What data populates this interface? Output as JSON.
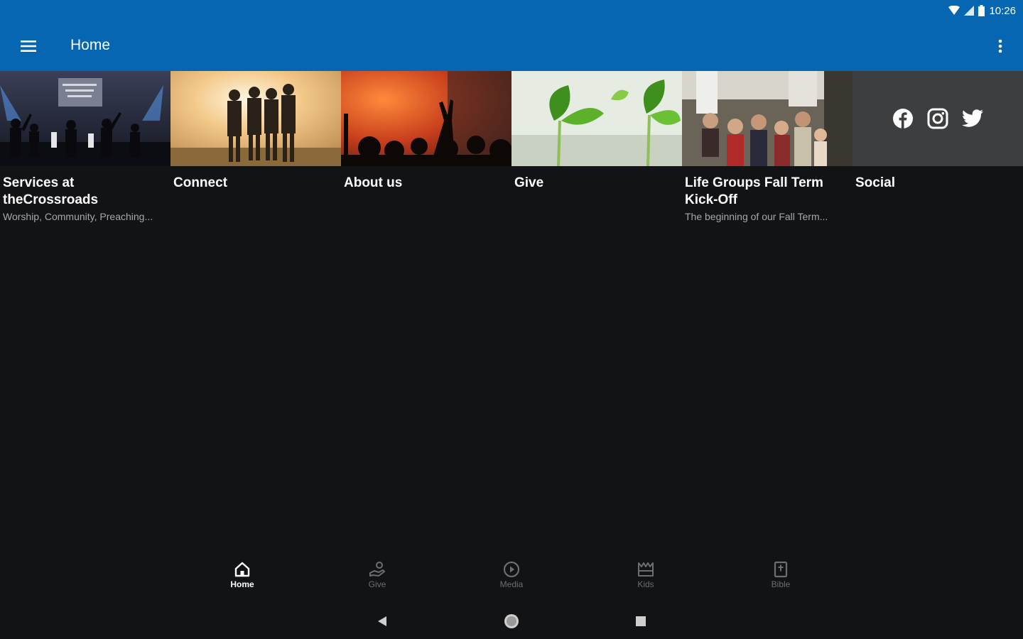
{
  "status_bar": {
    "time": "10:26"
  },
  "app_bar": {
    "title": "Home"
  },
  "tiles": [
    {
      "title": "Services at theCrossroads",
      "subtitle": "Worship, Community, Preaching..."
    },
    {
      "title": "Connect",
      "subtitle": ""
    },
    {
      "title": "About us",
      "subtitle": ""
    },
    {
      "title": "Give",
      "subtitle": ""
    },
    {
      "title": "Life Groups Fall Term Kick-Off",
      "subtitle": "The beginning of our Fall Term..."
    },
    {
      "title": "Social",
      "subtitle": ""
    }
  ],
  "social_icons": [
    "facebook-icon",
    "instagram-icon",
    "twitter-icon"
  ],
  "bottom_nav": [
    {
      "label": "Home",
      "icon": "home-icon",
      "active": true
    },
    {
      "label": "Give",
      "icon": "give-icon",
      "active": false
    },
    {
      "label": "Media",
      "icon": "play-circle-icon",
      "active": false
    },
    {
      "label": "Kids",
      "icon": "kids-icon",
      "active": false
    },
    {
      "label": "Bible",
      "icon": "bible-icon",
      "active": false
    }
  ],
  "colors": {
    "app_bar": "#0766b1",
    "background": "#121315",
    "social_tile": "#3d3e40",
    "inactive_nav": "#6d6e70"
  }
}
